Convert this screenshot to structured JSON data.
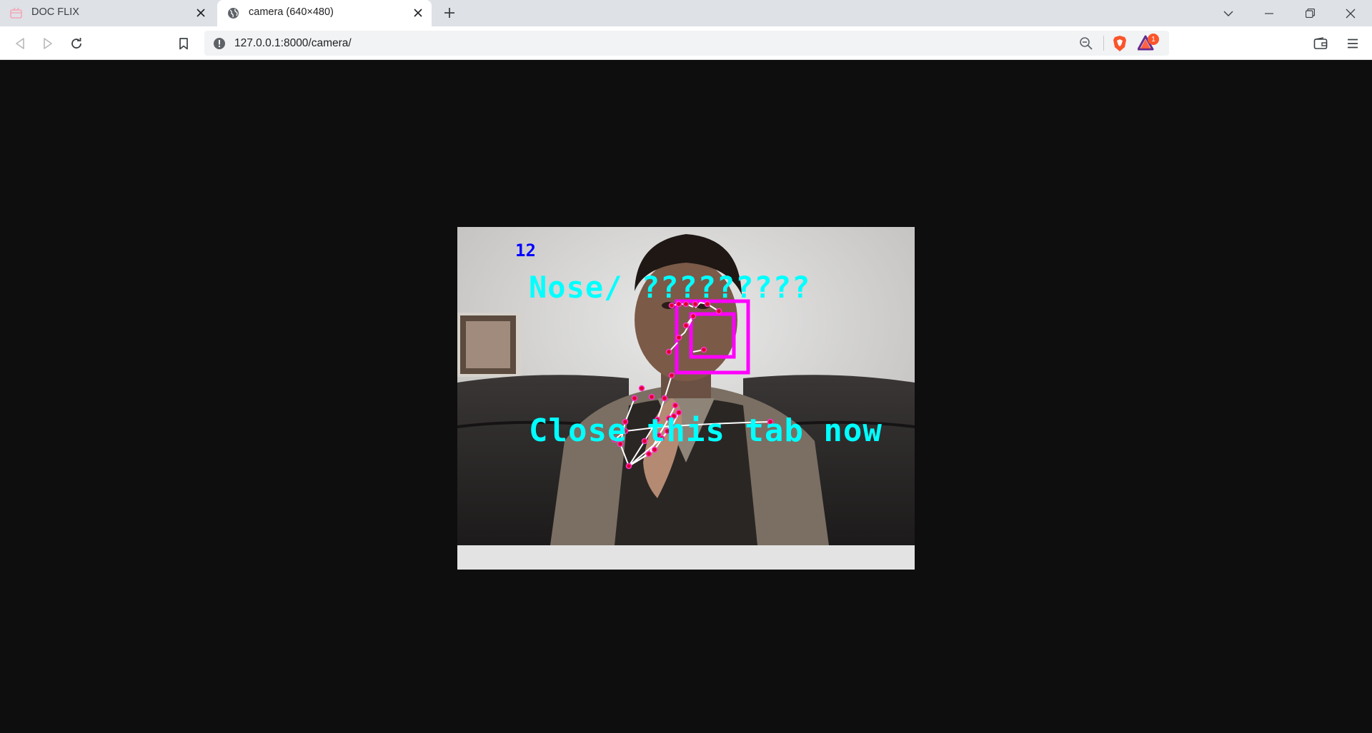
{
  "browser": {
    "tabs": [
      {
        "title": "DOC FLIX",
        "active": false,
        "icon": "doc-flix-icon"
      },
      {
        "title": "camera (640×480)",
        "active": true,
        "icon": "globe-icon"
      }
    ],
    "address_bar": {
      "url": "127.0.0.1:8000/camera/"
    },
    "rewards_badge_count": "1"
  },
  "camera": {
    "fps_text": "12",
    "status_text": "Nose/ ?????????",
    "instruction_text": "Close this tab now",
    "colors": {
      "overlay_text": "#00ffff",
      "fps_text": "#0000ff",
      "face_boxes": "#ff00ff",
      "landmark_points": "#e0002a",
      "skeleton_lines": "#ffffff"
    }
  }
}
